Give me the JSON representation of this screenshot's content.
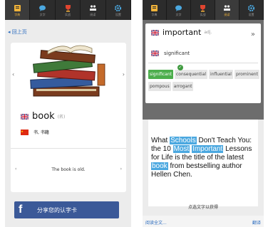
{
  "tabs": [
    {
      "label": "字典",
      "icon": "dictionary-icon"
    },
    {
      "label": "文字",
      "icon": "chat-bubble-icon"
    },
    {
      "label": "实战",
      "icon": "trophy-icon"
    },
    {
      "label": "阅读",
      "icon": "reading-icon"
    },
    {
      "label": "设置",
      "icon": "gear-icon"
    }
  ],
  "left": {
    "back_label": "回上页",
    "word": "book",
    "pos": "(名)",
    "translation": "书, 书籍",
    "sentence": "The book is old.",
    "share_label": "分享您的认字卡"
  },
  "right": {
    "word": "important",
    "pos": "adj.",
    "meaning": "significant",
    "synonyms": [
      "significant",
      "consequential",
      "influential",
      "prominent",
      "pompous",
      "arrogant"
    ],
    "article": {
      "segments": [
        {
          "text": "What ",
          "hl": false
        },
        {
          "text": "Schools",
          "hl": true
        },
        {
          "text": " Don't Teach You: the 10 ",
          "hl": false
        },
        {
          "text": "Most",
          "hl": true
        },
        {
          "text": " ",
          "hl": false
        },
        {
          "text": "Important",
          "hl": true
        },
        {
          "text": " Lessons for Life is the title of the latest ",
          "hl": false
        },
        {
          "text": "book",
          "hl": true
        },
        {
          "text": " from bestselling author Hellen Chen.",
          "hl": false
        }
      ]
    },
    "hint": "点选文字以获得",
    "read_full": "阅读全文...",
    "translate": "翻译"
  },
  "colors": {
    "highlight": "#4ba8e0",
    "selected_chip": "#4cae4c",
    "share": "#3b5998",
    "tab_active": "#f0b33a"
  }
}
